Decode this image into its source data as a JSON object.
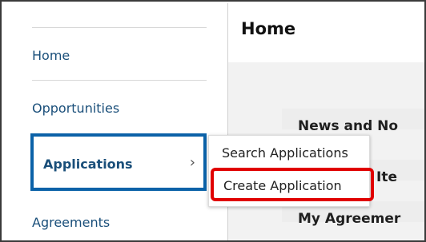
{
  "sidebar": {
    "items": [
      {
        "label": "Home"
      },
      {
        "label": "Opportunities"
      },
      {
        "label": "Applications",
        "active": true
      },
      {
        "label": "Agreements"
      }
    ]
  },
  "main": {
    "title": "Home",
    "card_lines": [
      "News and No",
      "Ite",
      "My Agreemer"
    ]
  },
  "flyout": {
    "items": [
      {
        "label": "Search Applications"
      },
      {
        "label": "Create Application",
        "highlighted": true
      }
    ]
  },
  "colors": {
    "active_border": "#0b62a8",
    "highlight_border": "#e00000",
    "nav_text": "#1a4f7a"
  },
  "icons": {
    "chevron": "chevron-right-icon"
  }
}
